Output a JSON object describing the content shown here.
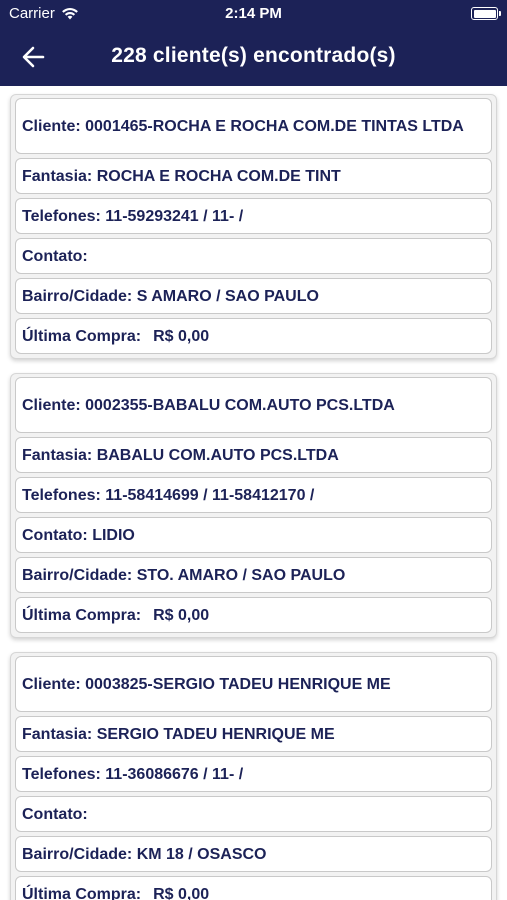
{
  "status_bar": {
    "carrier": "Carrier",
    "time": "2:14 PM",
    "battery_level": 1.0
  },
  "nav": {
    "back_icon": "arrow-left-icon",
    "title": "228 cliente(s) encontrado(s)"
  },
  "colors": {
    "header_bg": "#1c2257",
    "text": "#1c2257",
    "card_bg": "#f2f2f2",
    "row_border": "#c9c9c9"
  },
  "clients": [
    {
      "cliente": "Cliente: 0001465-ROCHA E ROCHA COM.DE TINTAS LTDA",
      "fantasia": "Fantasia: ROCHA E ROCHA COM.DE TINT",
      "telefones": "Telefones: 11-59293241 / 11- /",
      "contato": "Contato:",
      "bairro_cidade": "Bairro/Cidade: S AMARO / SAO PAULO",
      "ultima_compra_label": "Última Compra:",
      "ultima_compra_value": "R$ 0,00"
    },
    {
      "cliente": "Cliente: 0002355-BABALU COM.AUTO PCS.LTDA",
      "fantasia": "Fantasia: BABALU COM.AUTO PCS.LTDA",
      "telefones": "Telefones: 11-58414699 / 11-58412170 /",
      "contato": "Contato: LIDIO",
      "bairro_cidade": "Bairro/Cidade: STO. AMARO / SAO PAULO",
      "ultima_compra_label": "Última Compra:",
      "ultima_compra_value": "R$ 0,00"
    },
    {
      "cliente": "Cliente: 0003825-SERGIO TADEU HENRIQUE ME",
      "fantasia": "Fantasia: SERGIO TADEU HENRIQUE ME",
      "telefones": "Telefones: 11-36086676 / 11- /",
      "contato": "Contato:",
      "bairro_cidade": "Bairro/Cidade: KM 18 / OSASCO",
      "ultima_compra_label": "Última Compra:",
      "ultima_compra_value": "R$ 0,00"
    }
  ]
}
